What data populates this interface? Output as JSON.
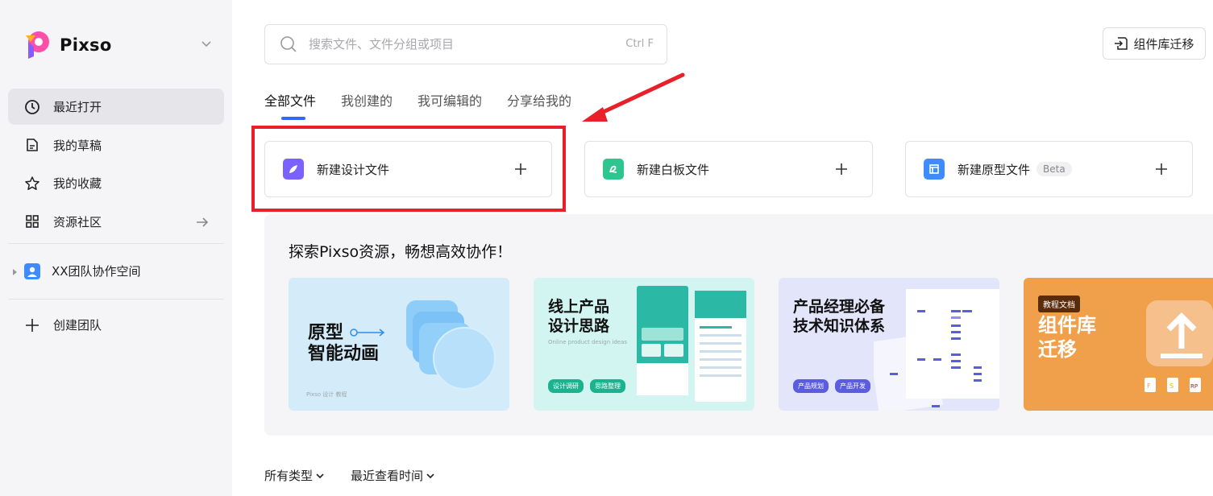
{
  "brand": {
    "name": "Pixso"
  },
  "sidebar": {
    "items": [
      {
        "label": "最近打开",
        "icon": "clock-icon"
      },
      {
        "label": "我的草稿",
        "icon": "draft-icon"
      },
      {
        "label": "我的收藏",
        "icon": "star-icon"
      },
      {
        "label": "资源社区",
        "icon": "grid-icon"
      }
    ],
    "team": {
      "label": "XX团队协作空间",
      "icon": "team-avatar-icon"
    },
    "create_team": {
      "label": "创建团队",
      "icon": "plus-icon"
    }
  },
  "search": {
    "placeholder": "搜索文件、文件分组或项目",
    "shortcut": "Ctrl F"
  },
  "header": {
    "migrate_label": "组件库迁移"
  },
  "tabs": [
    {
      "label": "全部文件",
      "active": true
    },
    {
      "label": "我创建的",
      "active": false
    },
    {
      "label": "我可编辑的",
      "active": false
    },
    {
      "label": "分享给我的",
      "active": false
    }
  ],
  "new_files": {
    "design": {
      "label": "新建设计文件",
      "color": "#7b61ff"
    },
    "whiteboard": {
      "label": "新建白板文件",
      "color": "#2ec58f"
    },
    "prototype": {
      "label": "新建原型文件",
      "badge": "Beta",
      "color": "#3d8bfd"
    }
  },
  "explore": {
    "title": "探索Pixso资源，畅想高效协作！",
    "banners": [
      {
        "title_line1": "原型",
        "title_line2": "智能动画",
        "footer": "Pixso 设计 教程"
      },
      {
        "title_line1": "线上产品",
        "title_line2": "设计思路",
        "subtitle": "Online product design ideas",
        "tags": [
          "设计调研",
          "思路整理"
        ]
      },
      {
        "title_line1": "产品经理必备",
        "title_line2": "技术知识体系",
        "tags": [
          "产品规划",
          "产品开发"
        ]
      },
      {
        "badge": "教程文档",
        "title_line1": "组件库",
        "title_line2": "迁移",
        "file_types": [
          "F",
          "S",
          "RP"
        ]
      }
    ]
  },
  "filters": {
    "type_label": "所有类型",
    "sort_label": "最近查看时间"
  },
  "colors": {
    "accent": "#2c6cf6",
    "highlight": "#e8202a",
    "sidebar_bg": "#f5f5f7"
  }
}
